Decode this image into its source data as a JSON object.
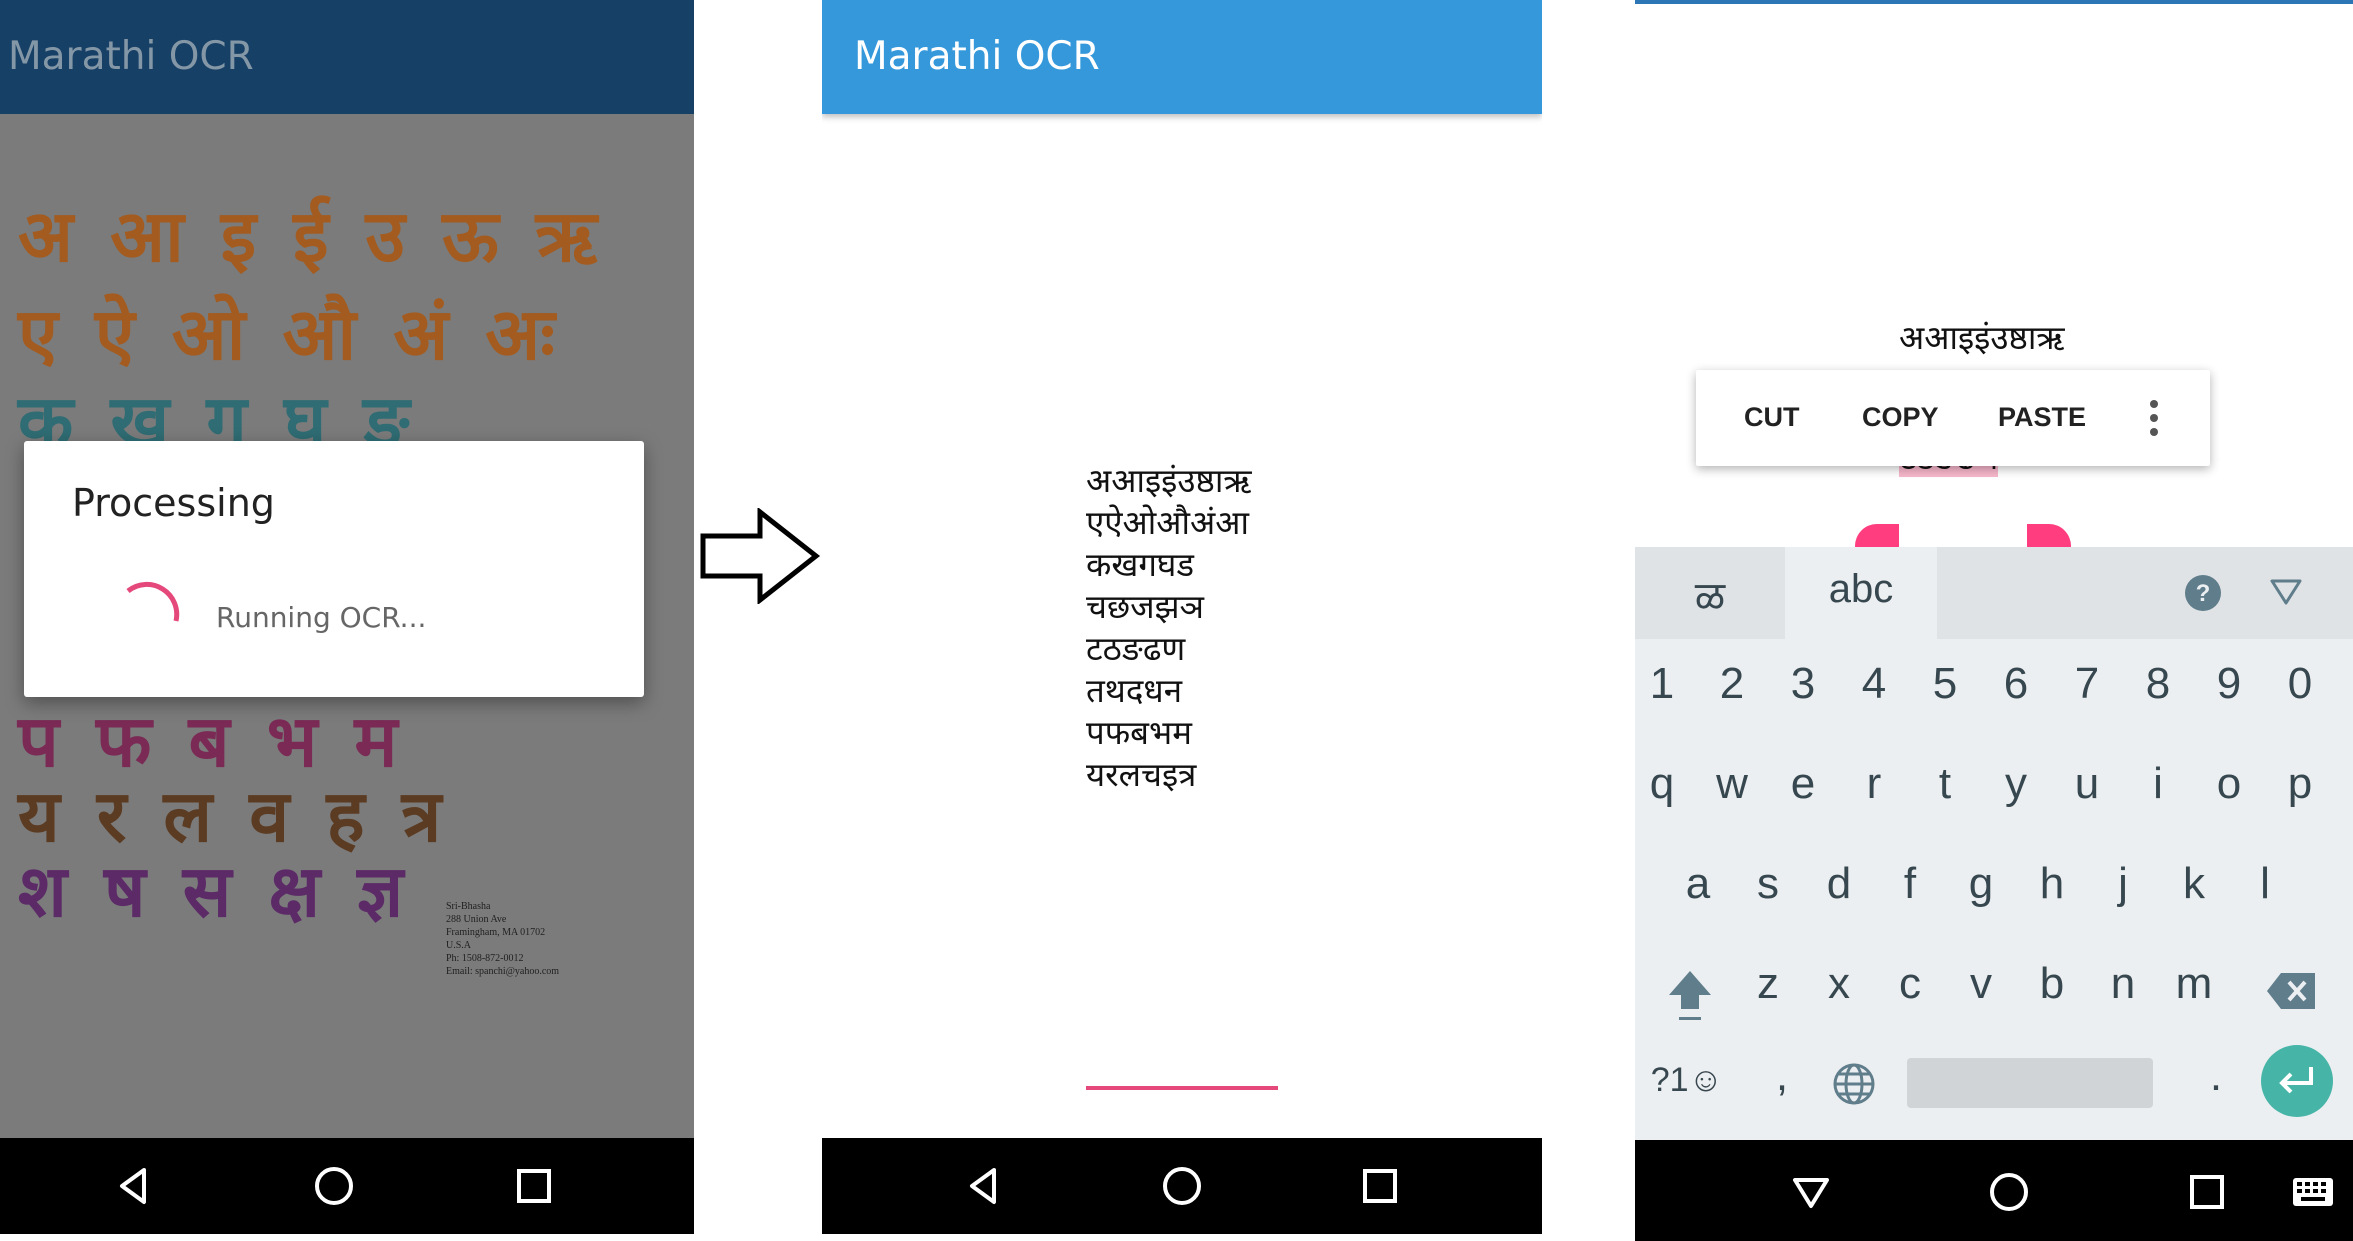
{
  "panel1": {
    "app_title": "Marathi OCR",
    "chart_rows": [
      "अ आ इ ई उ ऊ ऋ",
      "ए ऐ ओ औ अं अः",
      "क ख ग घ ङ",
      "प फ ब भ म",
      "य र ल व ह त्र",
      "श ष स क्ष ज्ञ"
    ],
    "address_lines": [
      "Sri-Bhasha",
      "288 Union Ave",
      "Framingham, MA 01702",
      "U.S.A",
      "Ph: 1508-872-0012",
      "Email: spanchi@yahoo.com"
    ],
    "dialog": {
      "title": "Processing",
      "message": "Running OCR..."
    }
  },
  "panel2": {
    "app_title": "Marathi OCR",
    "ocr_lines": [
      "अआइइंउष्ठाऋ",
      "एऐओऔअंआ",
      "कखगघड",
      "चछजझञ",
      "टठङढण",
      "तथदधन",
      "पफबभम",
      "यरलचइत्र"
    ]
  },
  "panel3": {
    "visible_text_top": "अआइइंउष्ठाऋ",
    "selected_text": "टठङढण",
    "context_menu": {
      "cut": "CUT",
      "copy": "COPY",
      "paste": "PASTE"
    },
    "keyboard": {
      "lang_tab": "ळ",
      "active_tab": "abc",
      "help_icon": "?",
      "number_row": [
        "1",
        "2",
        "3",
        "4",
        "5",
        "6",
        "7",
        "8",
        "9",
        "0"
      ],
      "row1": [
        "q",
        "w",
        "e",
        "r",
        "t",
        "y",
        "u",
        "i",
        "o",
        "p"
      ],
      "row2": [
        "a",
        "s",
        "d",
        "f",
        "g",
        "h",
        "j",
        "k",
        "l"
      ],
      "row3": [
        "z",
        "x",
        "c",
        "v",
        "b",
        "n",
        "m"
      ],
      "symbols_key": "?1☺",
      "comma_key": ",",
      "period_key": "."
    }
  },
  "colors": {
    "panel1_appbar": "#174066",
    "panel2_appbar": "#3598db",
    "accent_pink": "#e5487a",
    "enter_key": "#46b5a8"
  }
}
